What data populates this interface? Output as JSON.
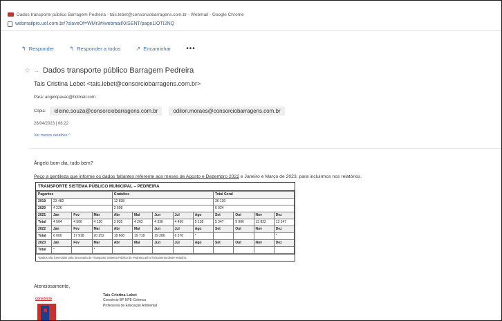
{
  "window": {
    "title": "Dados transporte público Barragem Pedreira - tais.lebet@consorciobarragens.com.br - Webmail - Google Chrome",
    "url": "webmailpro.uol.com.br/?slaveOf=WMr3#/webmail/0/SENT/page1/OTI2NQ"
  },
  "toolbar": {
    "reply": "Responder",
    "reply_all": "Responder a todos",
    "forward": "Encaminhar",
    "more": "•••"
  },
  "message": {
    "subject": "Dados transporte público Barragem Pedreira",
    "sender_name": "Tais Cristina Lebet",
    "sender_email": "<tais.lebet@consorciobarragens.com.br>",
    "to_label": "Para:",
    "to": "angelopavao@hotmail.com",
    "cc_label": "Cópia:",
    "cc": [
      "eleine.souza@consorciobarragens.com.br",
      "odilon.moraes@consorciobarragens.com.br"
    ],
    "date": "28/04/2023 | 08:22",
    "details_link": "Ver menos detalhes ^",
    "greeting": "Ângelo bom dia, tudo bem?",
    "intro_underlined": "Peço a gentileza que informe os dados faltantes referente aos meses de Agosto e Dezembro 2022",
    "intro_rest": " e Janeiro e Março de 2023, para incluirmos nos relatórios.",
    "closing": "Atenciosamente,"
  },
  "table": {
    "caption": "TRANSPORTE SISTEMA PÚBLICO MUNICIPAL – PEDREIRA",
    "summary_header": [
      "Pagantes",
      "Gratuitos",
      "Total Geral"
    ],
    "summary_rows": [
      {
        "year": "2019",
        "pagantes": "23 482",
        "gratuitos": "12 838",
        "total": "36 130"
      },
      {
        "year": "2020",
        "pagantes": "4 226",
        "gratuitos": "2 698",
        "total": "6 924"
      }
    ],
    "months": [
      "Jan",
      "Fev",
      "Mar",
      "Abr",
      "Mai",
      "Jun",
      "Jul",
      "Ago",
      "Set",
      "Out",
      "Nov",
      "Dez"
    ],
    "total_label": "Total",
    "years": [
      {
        "year": "2021",
        "totals": [
          "4 504",
          "4 506",
          "4 120",
          "3 835",
          "4 263",
          "4 336",
          "4 456",
          "5 138",
          "5 347",
          "9 906",
          "13 822",
          "13 147"
        ]
      },
      {
        "year": "2022",
        "totals": [
          "6 000",
          "17 918",
          "20 252",
          "18 608",
          "19 718",
          "19 286",
          "6 370",
          "*",
          "",
          "",
          "",
          "*"
        ]
      },
      {
        "year": "2023",
        "totals": [
          "*",
          "",
          "*",
          "",
          "",
          "",
          "",
          "",
          "",
          "",
          "",
          ""
        ]
      }
    ],
    "note": "*Dados não fornecidos pela Secretaria de Transporte Sistema Público de Pedreira até o fechamento deste relatório."
  },
  "signature": {
    "logo_text": "consórcio",
    "name": "Tais Cristina Lebet",
    "company": "Consórcio BP KPE-Celenca",
    "role": "Professora de Educação Ambiental"
  }
}
